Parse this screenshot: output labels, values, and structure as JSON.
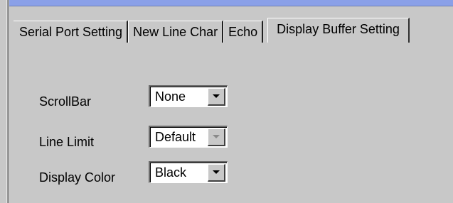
{
  "tabs": [
    {
      "label": "Serial Port Setting",
      "active": false
    },
    {
      "label": "New Line Char",
      "active": false
    },
    {
      "label": "Echo",
      "active": false
    },
    {
      "label": "Display Buffer Setting",
      "active": true
    }
  ],
  "settings": {
    "scrollbar": {
      "label": "ScrollBar",
      "value": "None"
    },
    "line_limit": {
      "label": "Line Limit",
      "value": "Default",
      "disabled_arrow": true
    },
    "display_color": {
      "label": "Display Color",
      "value": "Black"
    }
  },
  "colors": {
    "window_bg": "#c8c8c8",
    "titlebar": "#8aa0e8"
  },
  "icons": {
    "dropdown": "chevron-down-icon"
  }
}
